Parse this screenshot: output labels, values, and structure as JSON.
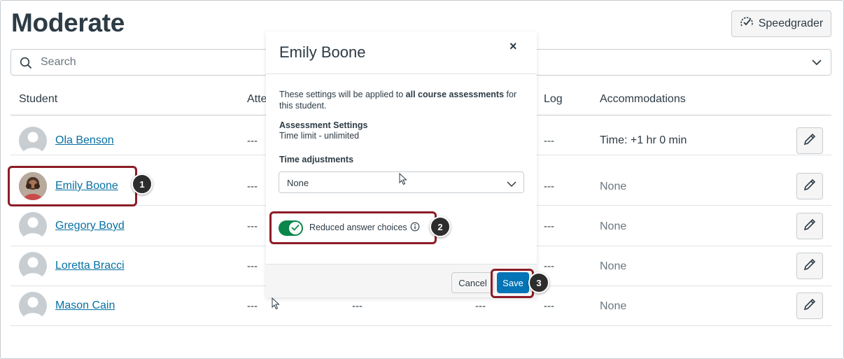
{
  "page": {
    "title": "Moderate"
  },
  "toolbar": {
    "speedgrader_label": "Speedgrader"
  },
  "search": {
    "placeholder": "Search"
  },
  "table": {
    "headers": {
      "student": "Student",
      "attempts": "Atte",
      "log": "Log",
      "accommodations": "Accommodations"
    },
    "rows": [
      {
        "name": "Ola Benson",
        "attempts": "---",
        "log": "---",
        "accommodations": "Time: +1 hr 0 min"
      },
      {
        "name": "Emily Boone",
        "attempts": "---",
        "log": "---",
        "accommodations": "None"
      },
      {
        "name": "Gregory Boyd",
        "attempts": "---",
        "log": "---",
        "accommodations": "None"
      },
      {
        "name": "Loretta Bracci",
        "attempts": "---",
        "log": "---",
        "accommodations": "None"
      },
      {
        "name": "Mason Cain",
        "attempts": "---",
        "col3": "---",
        "col4": "---",
        "log": "---",
        "accommodations": "None"
      }
    ]
  },
  "modal": {
    "title": "Emily Boone",
    "close_label": "×",
    "intro_prefix": "These settings will be applied to ",
    "intro_bold": "all course assessments",
    "intro_suffix": " for this student.",
    "assessment_settings_heading": "Assessment Settings",
    "assessment_settings_value": "Time limit - unlimited",
    "time_adjustments_heading": "Time adjustments",
    "time_adjustments_value": "None",
    "reduced_choices_label": "Reduced answer choices",
    "reduced_choices_enabled": true,
    "cancel_label": "Cancel",
    "save_label": "Save"
  },
  "callouts": [
    "1",
    "2",
    "3"
  ],
  "colors": {
    "link": "#0770a3",
    "primary": "#0374b5",
    "toggle_on": "#0b874b",
    "callout_border": "#8c1c27"
  }
}
